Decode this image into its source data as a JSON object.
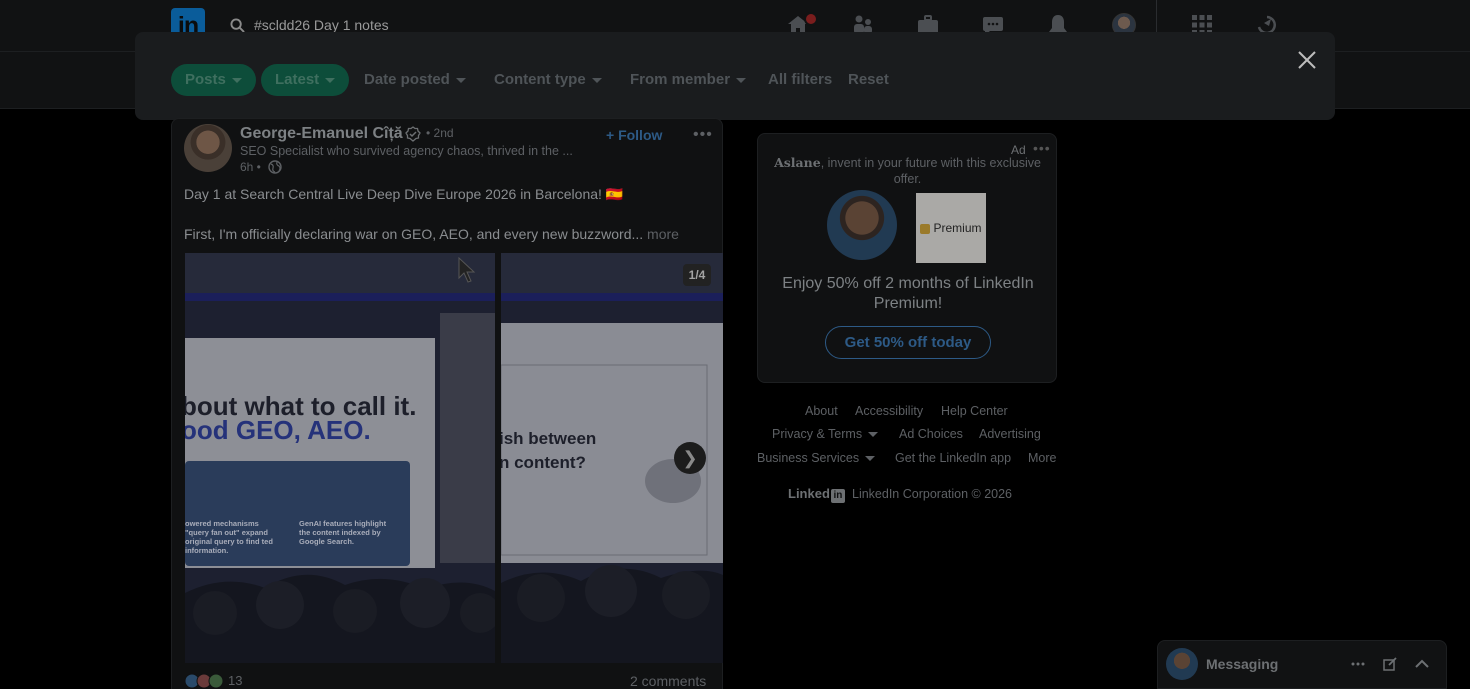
{
  "nav": {
    "search_value": "#scldd26 Day 1 notes",
    "logo_text": "in",
    "icons": [
      "home-icon",
      "my-network-icon",
      "jobs-icon",
      "messaging-icon",
      "notifications-icon",
      "me-avatar",
      "work-grid-icon",
      "learning-icon"
    ]
  },
  "filters": {
    "posts": "Posts",
    "latest": "Latest",
    "date_posted": "Date posted",
    "content_type": "Content type",
    "from_member": "From member",
    "all_filters": "All filters",
    "reset": "Reset"
  },
  "post": {
    "author": "George-Emanuel Cîță",
    "degree": "• 2nd",
    "headline": "SEO Specialist who survived agency chaos, thrived in the ...",
    "time": "6h •",
    "follow": "+ Follow",
    "text_line1": "Day 1 at Search Central Live Deep Dive Europe 2026 in Barcelona! 🇪🇸",
    "text_line2": "First, I'm officially declaring war on GEO, AEO, and every new buzzword...",
    "see_more": "more",
    "image_counter": "1/4",
    "slide1_line1": "bout what to call it.",
    "slide1_line2": "ood GEO, AEO.",
    "slide1_box_left": "owered mechanisms \"query fan out\" expand original query to find ted information.",
    "slide1_box_right": "GenAI features highlight the content indexed by Google Search.",
    "slide2_line1": "ish between",
    "slide2_line2": "n content?",
    "reaction_count": "13",
    "comments": "2 comments"
  },
  "ad": {
    "label": "Ad",
    "name": "Aslane",
    "intro": ", invent in your future with this exclusive offer.",
    "premium_label": "Premium",
    "headline": "Enjoy 50% off 2 months of LinkedIn Premium!",
    "cta": "Get 50% off today"
  },
  "footer": {
    "about": "About",
    "accessibility": "Accessibility",
    "help_center": "Help Center",
    "privacy_terms": "Privacy & Terms",
    "ad_choices": "Ad Choices",
    "advertising": "Advertising",
    "business_services": "Business Services",
    "get_app": "Get the LinkedIn app",
    "more": "More",
    "brand": "Linked",
    "brand_in": "in",
    "copyright": "LinkedIn Corporation © 2026"
  },
  "messaging": {
    "title": "Messaging"
  }
}
